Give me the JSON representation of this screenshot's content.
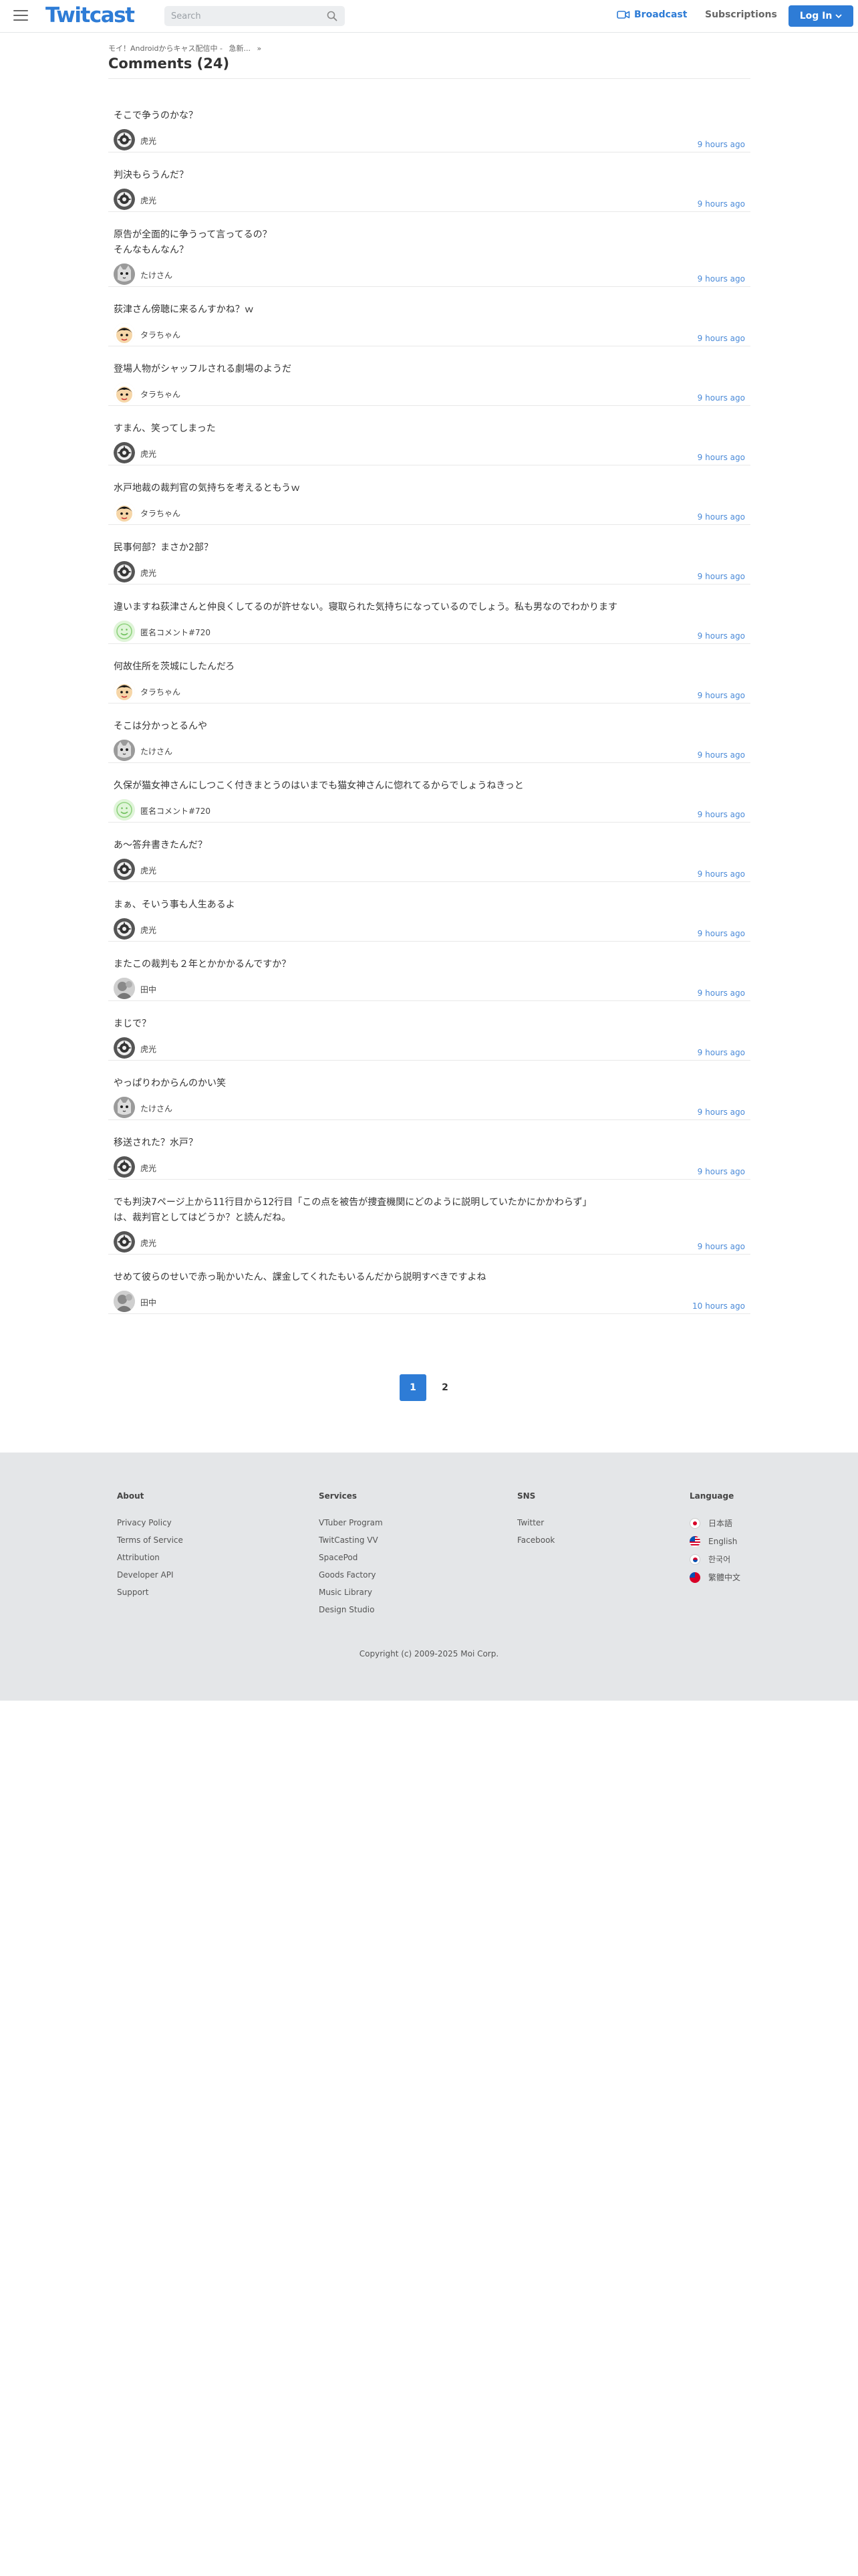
{
  "header": {
    "logo": "Twitcast",
    "search_placeholder": "Search",
    "broadcast": "Broadcast",
    "subscriptions": "Subscriptions",
    "login": "Log In"
  },
  "breadcrumb": [
    "モイ！Androidからキャス配信中 -",
    "急新...",
    "»"
  ],
  "page_title": "Comments (24)",
  "comments": [
    {
      "text": "そこで争うのかな？",
      "user": "虎光",
      "avatar": "tiger",
      "time": "9 hours ago"
    },
    {
      "text": "判決もらうんだ？",
      "user": "虎光",
      "avatar": "tiger",
      "time": "9 hours ago"
    },
    {
      "text": "原告が全面的に争うって言ってるの？\nそんなもんなん？",
      "user": "たけさん",
      "avatar": "cat",
      "time": "9 hours ago"
    },
    {
      "text": "荻津さん傍聴に来るんすかね？ｗ",
      "user": "タラちゃん",
      "avatar": "boy",
      "time": "9 hours ago"
    },
    {
      "text": "登場人物がシャッフルされる劇場のようだ",
      "user": "タラちゃん",
      "avatar": "boy",
      "time": "9 hours ago"
    },
    {
      "text": "すまん、笑ってしまった",
      "user": "虎光",
      "avatar": "tiger",
      "time": "9 hours ago"
    },
    {
      "text": "水戸地裁の裁判官の気持ちを考えるともうｗ",
      "user": "タラちゃん",
      "avatar": "boy",
      "time": "9 hours ago"
    },
    {
      "text": "民事何部？まさか2部？",
      "user": "虎光",
      "avatar": "tiger",
      "time": "9 hours ago"
    },
    {
      "text": "違いますね荻津さんと仲良くしてるのが許せない。寝取られた気持ちになっているのでしょう。私も男なのでわかります",
      "user": "匿名コメント#720",
      "avatar": "anon",
      "time": "9 hours ago"
    },
    {
      "text": "何故住所を茨城にしたんだろ",
      "user": "タラちゃん",
      "avatar": "boy",
      "time": "9 hours ago"
    },
    {
      "text": "そこは分かっとるんや",
      "user": "たけさん",
      "avatar": "cat",
      "time": "9 hours ago"
    },
    {
      "text": "久保が猫女神さんにしつこく付きまとうのはいまでも猫女神さんに惚れてるからでしょうねきっと",
      "user": "匿名コメント#720",
      "avatar": "anon",
      "time": "9 hours ago"
    },
    {
      "text": "あ〜答弁書きたんだ？",
      "user": "虎光",
      "avatar": "tiger",
      "time": "9 hours ago"
    },
    {
      "text": "まぁ、そいう事も人生あるよ",
      "user": "虎光",
      "avatar": "tiger",
      "time": "9 hours ago"
    },
    {
      "text": "またこの裁判も２年とかかかるんですか？",
      "user": "田中",
      "avatar": "grey",
      "time": "9 hours ago"
    },
    {
      "text": "まじで？",
      "user": "虎光",
      "avatar": "tiger",
      "time": "9 hours ago"
    },
    {
      "text": "やっぱりわからんのかい笑",
      "user": "たけさん",
      "avatar": "cat",
      "time": "9 hours ago"
    },
    {
      "text": "移送された？水戸？",
      "user": "虎光",
      "avatar": "tiger",
      "time": "9 hours ago"
    },
    {
      "text": "でも判決7ページ上から11行目から12行目「この点を被告が捜査機関にどのように説明していたかにかかわらず」\nは、裁判官としてはどうか？と読んだね。",
      "user": "虎光",
      "avatar": "tiger",
      "time": "9 hours ago"
    },
    {
      "text": "せめて彼らのせいで赤っ恥かいたん、課金してくれたもいるんだから説明すべきですよね",
      "user": "田中",
      "avatar": "grey",
      "time": "10 hours ago"
    }
  ],
  "pagination": {
    "current": "1",
    "next": "2"
  },
  "footer": {
    "about": {
      "title": "About",
      "links": [
        "Privacy Policy",
        "Terms of Service",
        "Attribution",
        "Developer API",
        "Support"
      ]
    },
    "services": {
      "title": "Services",
      "links": [
        "VTuber Program",
        "TwitCasting VV",
        "SpacePod",
        "Goods Factory",
        "Music Library",
        "Design Studio"
      ]
    },
    "sns": {
      "title": "SNS",
      "links": [
        "Twitter",
        "Facebook"
      ]
    },
    "language": {
      "title": "Language",
      "items": [
        {
          "label": "日本語",
          "flag": "jp-flag-icon"
        },
        {
          "label": "English",
          "flag": "us-flag-icon"
        },
        {
          "label": "한국어",
          "flag": "kr-flag-icon"
        },
        {
          "label": "繁體中文",
          "flag": "tw-flag-icon"
        }
      ]
    },
    "copyright": "Copyright (c) 2009-2025 Moi Corp."
  },
  "colors": {
    "accent": "#2e7cd6",
    "time": "#4a8ad8",
    "footer_bg": "#e4e6e8"
  }
}
